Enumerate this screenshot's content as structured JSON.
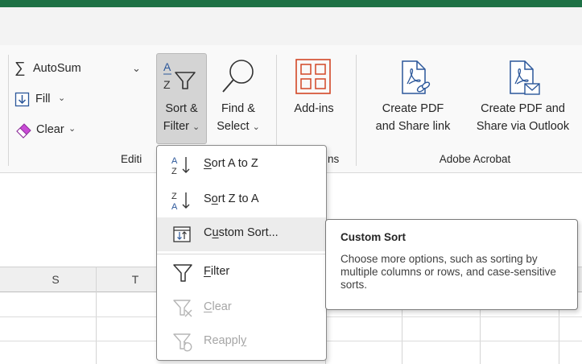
{
  "ribbon": {
    "editing": {
      "autosum_label": "AutoSum",
      "fill_label": "Fill",
      "clear_label": "Clear",
      "caret": "⌄",
      "group_label": "Editi",
      "sort_filter": {
        "line1": "Sort &",
        "line2": "Filter"
      },
      "find_select": {
        "line1": "Find &",
        "line2": "Select"
      }
    },
    "addins": {
      "label": "Add-ins",
      "group_label_partial": "ns"
    },
    "acrobat": {
      "create_pdf_link": {
        "line1": "Create PDF",
        "line2": "and Share link"
      },
      "create_pdf_outlook": {
        "line1": "Create PDF and",
        "line2": "Share via Outlook"
      },
      "group_label": "Adobe Acrobat"
    }
  },
  "sort_menu": {
    "items": [
      {
        "label_pre": "",
        "mnemonic": "S",
        "label_post": "ort A to Z",
        "icon": "sort-a-to-z-icon",
        "enabled": true
      },
      {
        "label_pre": "S",
        "mnemonic": "o",
        "label_post": "rt Z to A",
        "icon": "sort-z-to-a-icon",
        "enabled": true
      },
      {
        "label_pre": "C",
        "mnemonic": "u",
        "label_post": "stom Sort...",
        "icon": "custom-sort-icon",
        "enabled": true,
        "highlighted": true
      },
      {
        "label_pre": "",
        "mnemonic": "F",
        "label_post": "ilter",
        "icon": "filter-icon",
        "enabled": true
      },
      {
        "label_pre": "",
        "mnemonic": "C",
        "label_post": "lear",
        "icon": "clear-filter-icon",
        "enabled": false
      },
      {
        "label_pre": "Reappl",
        "mnemonic": "y",
        "label_post": "",
        "icon": "reapply-filter-icon",
        "enabled": false
      }
    ]
  },
  "tooltip": {
    "title": "Custom Sort",
    "body": "Choose more options, such as sorting by multiple columns or rows, and case-sensitive sorts."
  },
  "columns": [
    "S",
    "T"
  ],
  "colors": {
    "title_green": "#1e7145",
    "accent_blue": "#2b579a",
    "clear_purple": "#b13fbf",
    "addins_orange": "#d24726"
  }
}
